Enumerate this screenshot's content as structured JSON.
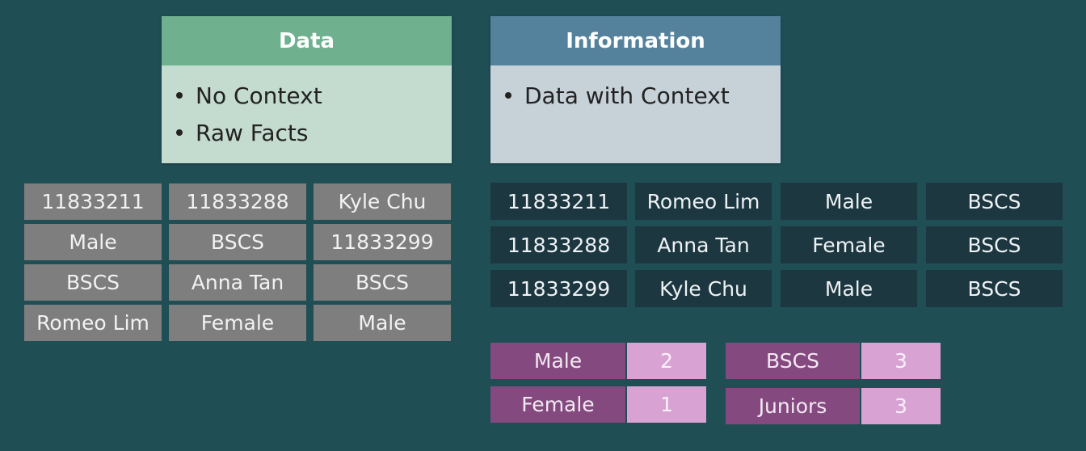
{
  "data_card": {
    "title": "Data",
    "bullets": [
      "No Context",
      "Raw Facts"
    ]
  },
  "info_card": {
    "title": "Information",
    "bullets": [
      "Data with Context"
    ]
  },
  "raw_data": [
    [
      "11833211",
      "11833288",
      "Kyle Chu"
    ],
    [
      "Male",
      "BSCS",
      "11833299"
    ],
    [
      "BSCS",
      "Anna Tan",
      "BSCS"
    ],
    [
      "Romeo Lim",
      "Female",
      "Male"
    ]
  ],
  "info_table": [
    [
      "11833211",
      "Romeo Lim",
      "Male",
      "BSCS"
    ],
    [
      "11833288",
      "Anna Tan",
      "Female",
      "BSCS"
    ],
    [
      "11833299",
      "Kyle Chu",
      "Male",
      "BSCS"
    ]
  ],
  "summary": {
    "gender": [
      {
        "label": "Male",
        "value": "2"
      },
      {
        "label": "Female",
        "value": "1"
      }
    ],
    "program": [
      {
        "label": "BSCS",
        "value": "3"
      },
      {
        "label": "Juniors",
        "value": "3"
      }
    ]
  },
  "colors": {
    "background": "#1f4e55",
    "data_header": "#6fb18e",
    "data_body": "#c4dbd0",
    "info_header": "#54829c",
    "info_body": "#c6d1d8",
    "raw_cell": "#7e7e7e",
    "info_cell": "#1d3741",
    "summary_label": "#844a80",
    "summary_value": "#d8a2d3"
  }
}
